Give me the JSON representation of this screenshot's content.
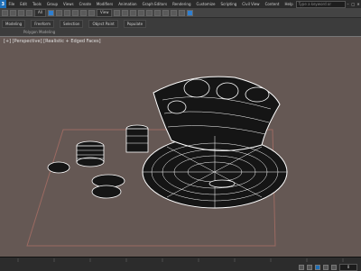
{
  "menubar": {
    "logo": "3",
    "items": [
      "File",
      "Edit",
      "Tools",
      "Group",
      "Views",
      "Create",
      "Modifiers",
      "Animation",
      "Graph Editors",
      "Rendering",
      "Customize",
      "Scripting",
      "Civil View",
      "Content",
      "Help"
    ],
    "search_placeholder": "Type a keyword or phrase",
    "window_buttons": [
      "–",
      "□",
      "✕"
    ]
  },
  "toolbar": {
    "selection_filter": "All",
    "view_select": "View"
  },
  "subbar": {
    "ribbon_groups": [
      "Modeling",
      "Freeform",
      "Selection",
      "Object Paint",
      "Populate"
    ],
    "mode_label": "Polygon Modeling"
  },
  "viewport": {
    "label": "[+] [Perspective] [Realistic + Edged Faces]",
    "colors": {
      "background": "#655854",
      "mesh_fill": "#151515",
      "wire": "#ffffff",
      "grid_line": "#9b6a62"
    }
  },
  "timeline": {
    "frame_field": "0",
    "controls": [
      "go-start-icon",
      "prev-frame-icon",
      "play-icon",
      "next-frame-icon",
      "go-end-icon"
    ]
  }
}
